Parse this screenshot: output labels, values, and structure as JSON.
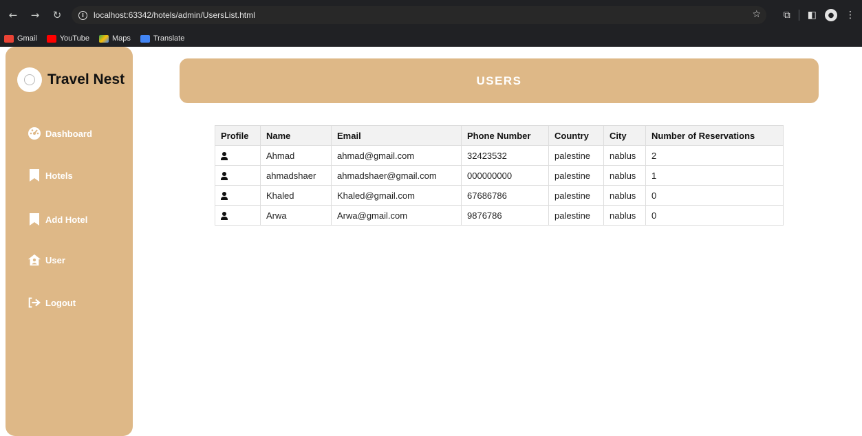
{
  "browser": {
    "url_host": "localhost:63342",
    "url_path": "/hotels/admin/UsersList.html",
    "bookmarks": [
      {
        "label": "Gmail",
        "color": "#ea4335"
      },
      {
        "label": "YouTube",
        "color": "#ff0000"
      },
      {
        "label": "Maps",
        "color": "#34a853"
      },
      {
        "label": "Translate",
        "color": "#4285f4"
      }
    ]
  },
  "sidebar": {
    "brand": "Travel Nest",
    "items": [
      {
        "label": "Dashboard",
        "icon": "dashboard-icon"
      },
      {
        "label": "Hotels",
        "icon": "bookmark-icon"
      },
      {
        "label": "Add Hotel",
        "icon": "bookmark-icon"
      },
      {
        "label": "User",
        "icon": "user-house-icon"
      },
      {
        "label": "Logout",
        "icon": "logout-icon"
      }
    ]
  },
  "main": {
    "title": "USERS",
    "table": {
      "headers": [
        "Profile",
        "Name",
        "Email",
        "Phone Number",
        "Country",
        "City",
        "Number of Reservations"
      ],
      "rows": [
        {
          "name": "Ahmad",
          "email": "ahmad@gmail.com",
          "phone": "32423532",
          "country": "palestine",
          "city": "nablus",
          "reservations": "2"
        },
        {
          "name": "ahmadshaer",
          "email": "ahmadshaer@gmail.com",
          "phone": "000000000",
          "country": "palestine",
          "city": "nablus",
          "reservations": "1"
        },
        {
          "name": "Khaled",
          "email": "Khaled@gmail.com",
          "phone": "67686786",
          "country": "palestine",
          "city": "nablus",
          "reservations": "0"
        },
        {
          "name": "Arwa",
          "email": "Arwa@gmail.com",
          "phone": "9876786",
          "country": "palestine",
          "city": "nablus",
          "reservations": "0"
        }
      ]
    }
  },
  "colors": {
    "accent": "#deb887",
    "chrome": "#202124"
  }
}
